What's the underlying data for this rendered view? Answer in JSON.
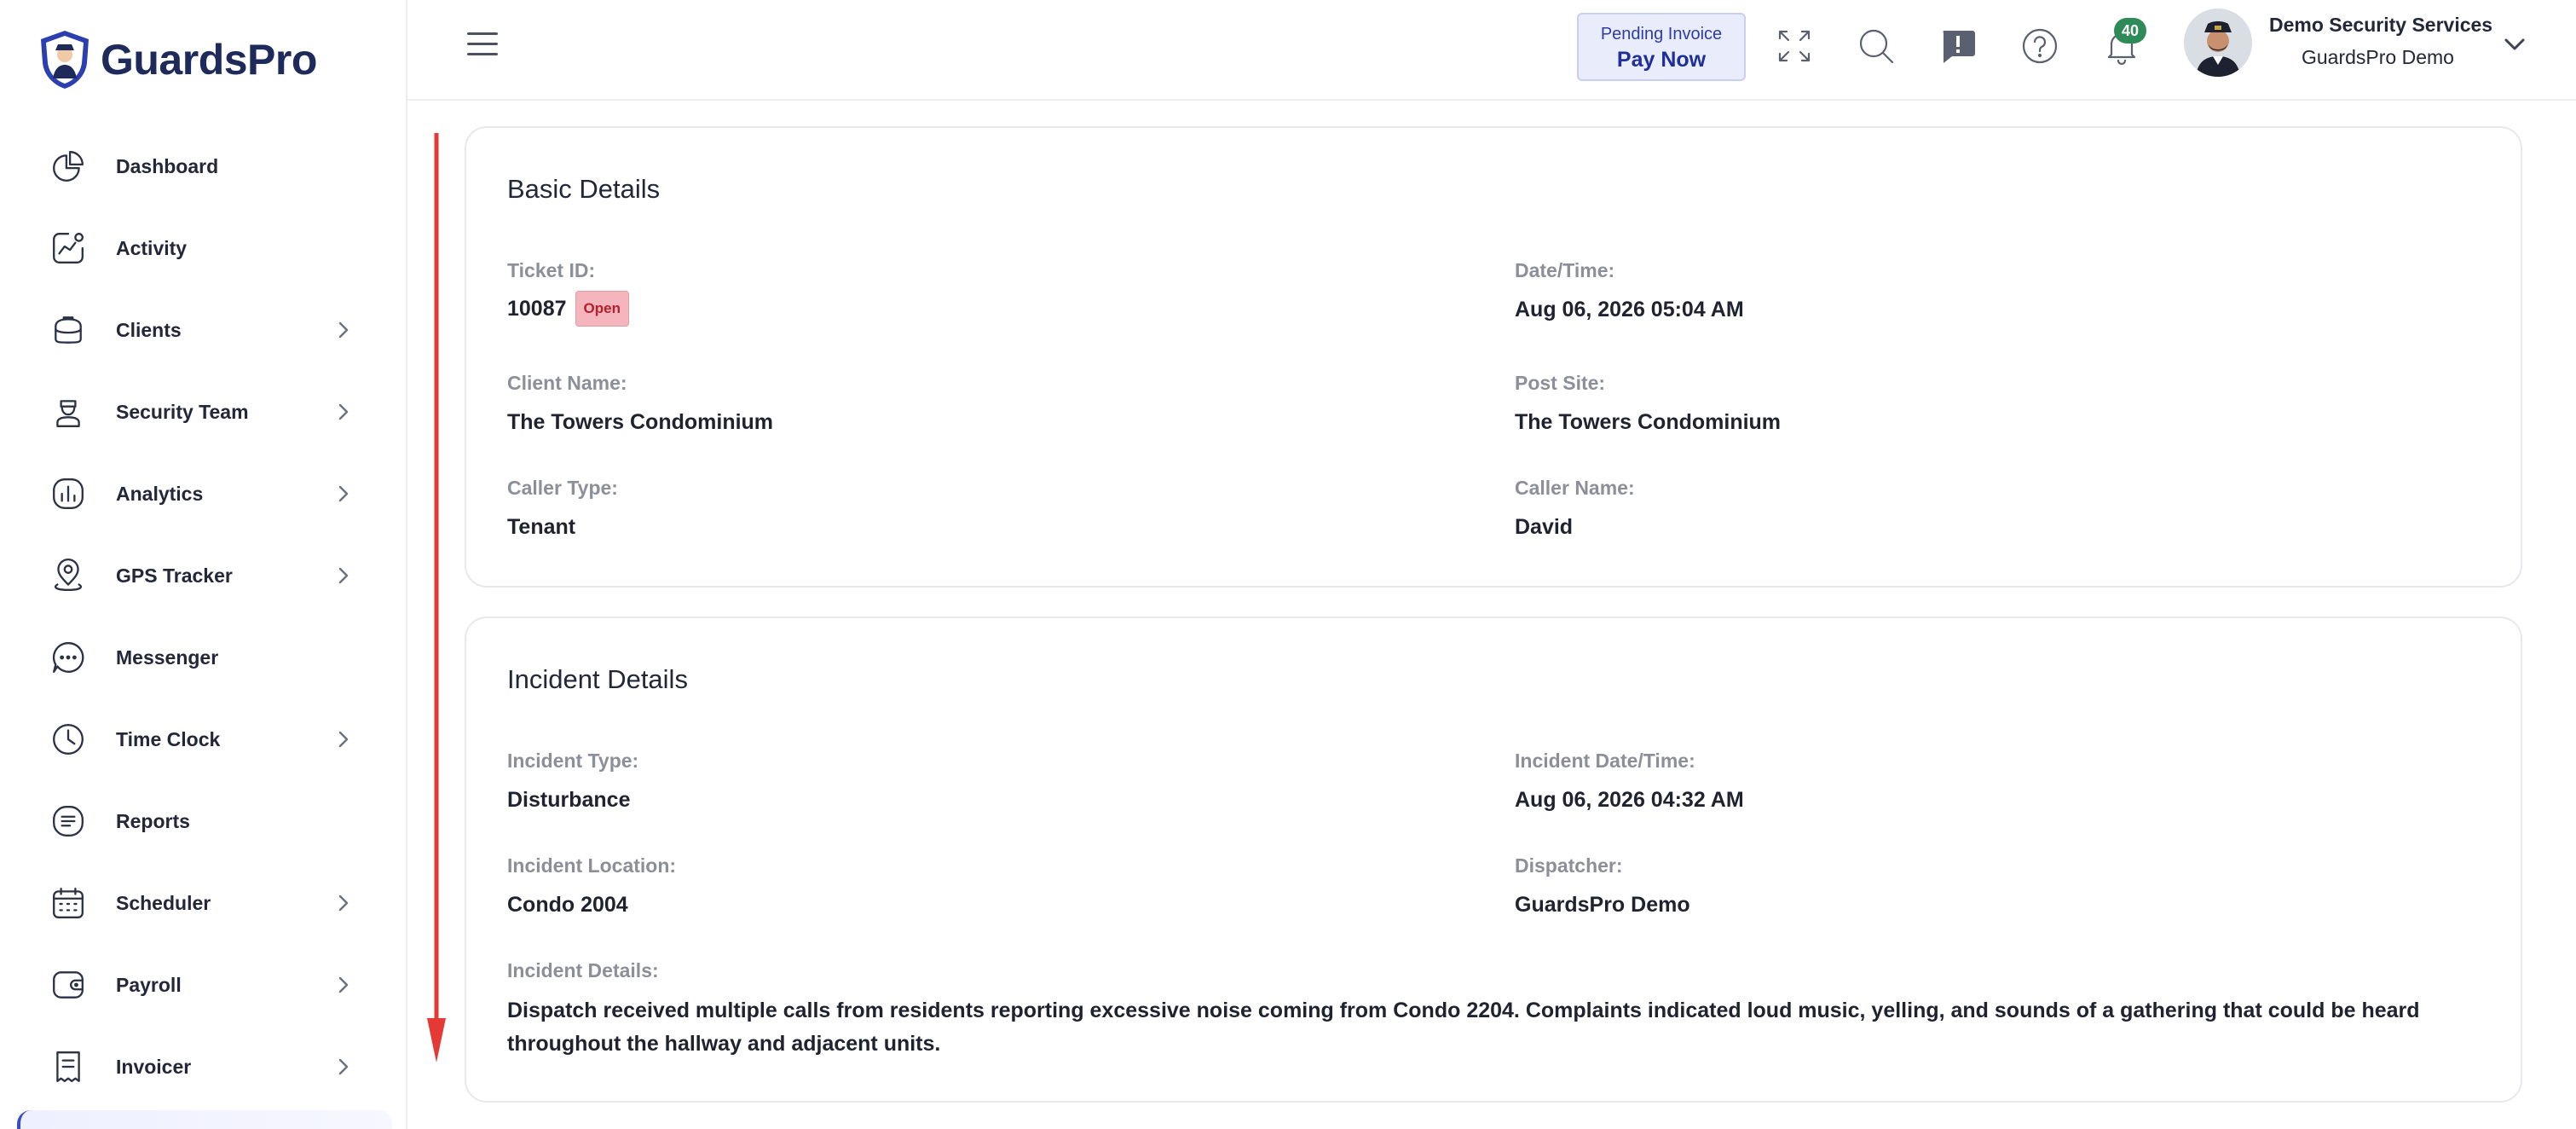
{
  "brand": {
    "name": "GuardsPro"
  },
  "sidebar": {
    "items": [
      {
        "label": "Dashboard",
        "icon": "pie-chart-icon",
        "has_children": false
      },
      {
        "label": "Activity",
        "icon": "activity-chart-icon",
        "has_children": false
      },
      {
        "label": "Clients",
        "icon": "briefcase-icon",
        "has_children": true
      },
      {
        "label": "Security Team",
        "icon": "guard-icon",
        "has_children": true
      },
      {
        "label": "Analytics",
        "icon": "analytics-icon",
        "has_children": true
      },
      {
        "label": "GPS Tracker",
        "icon": "location-pin-icon",
        "has_children": true
      },
      {
        "label": "Messenger",
        "icon": "chat-bubble-icon",
        "has_children": false
      },
      {
        "label": "Time Clock",
        "icon": "clock-icon",
        "has_children": true
      },
      {
        "label": "Reports",
        "icon": "report-icon",
        "has_children": false
      },
      {
        "label": "Scheduler",
        "icon": "calendar-icon",
        "has_children": true
      },
      {
        "label": "Payroll",
        "icon": "wallet-icon",
        "has_children": true
      },
      {
        "label": "Invoicer",
        "icon": "receipt-icon",
        "has_children": true
      }
    ]
  },
  "header": {
    "invoice": {
      "top": "Pending Invoice",
      "bottom": "Pay Now"
    },
    "notifications_count": "40",
    "user": {
      "name": "Demo Security Services",
      "org": "GuardsPro Demo"
    }
  },
  "basic_details": {
    "title": "Basic Details",
    "ticket_id_label": "Ticket ID:",
    "ticket_id": "10087",
    "status": "Open",
    "datetime_label": "Date/Time:",
    "datetime": "Aug 06, 2026 05:04 AM",
    "client_label": "Client Name:",
    "client": "The Towers Condominium",
    "post_site_label": "Post Site:",
    "post_site": "The Towers Condominium",
    "caller_type_label": "Caller Type:",
    "caller_type": "Tenant",
    "caller_name_label": "Caller Name:",
    "caller_name": "David"
  },
  "incident_details": {
    "title": "Incident Details",
    "type_label": "Incident Type:",
    "type": "Disturbance",
    "datetime_label": "Incident Date/Time:",
    "datetime": "Aug 06, 2026 04:32 AM",
    "location_label": "Incident Location:",
    "location": "Condo 2004",
    "dispatcher_label": "Dispatcher:",
    "dispatcher": "GuardsPro Demo",
    "details_label": "Incident Details:",
    "details": "Dispatch received multiple calls from residents reporting excessive noise coming from Condo 2204. Complaints indicated loud music, yelling, and sounds of a gathering that could be heard throughout the hallway and adjacent units."
  },
  "colors": {
    "brand": "#1e2a5a",
    "accent": "#1f2f9a",
    "badge": "#2e8b57",
    "status_open_bg": "#f4b6bc",
    "annotation_arrow": "#e53935"
  }
}
